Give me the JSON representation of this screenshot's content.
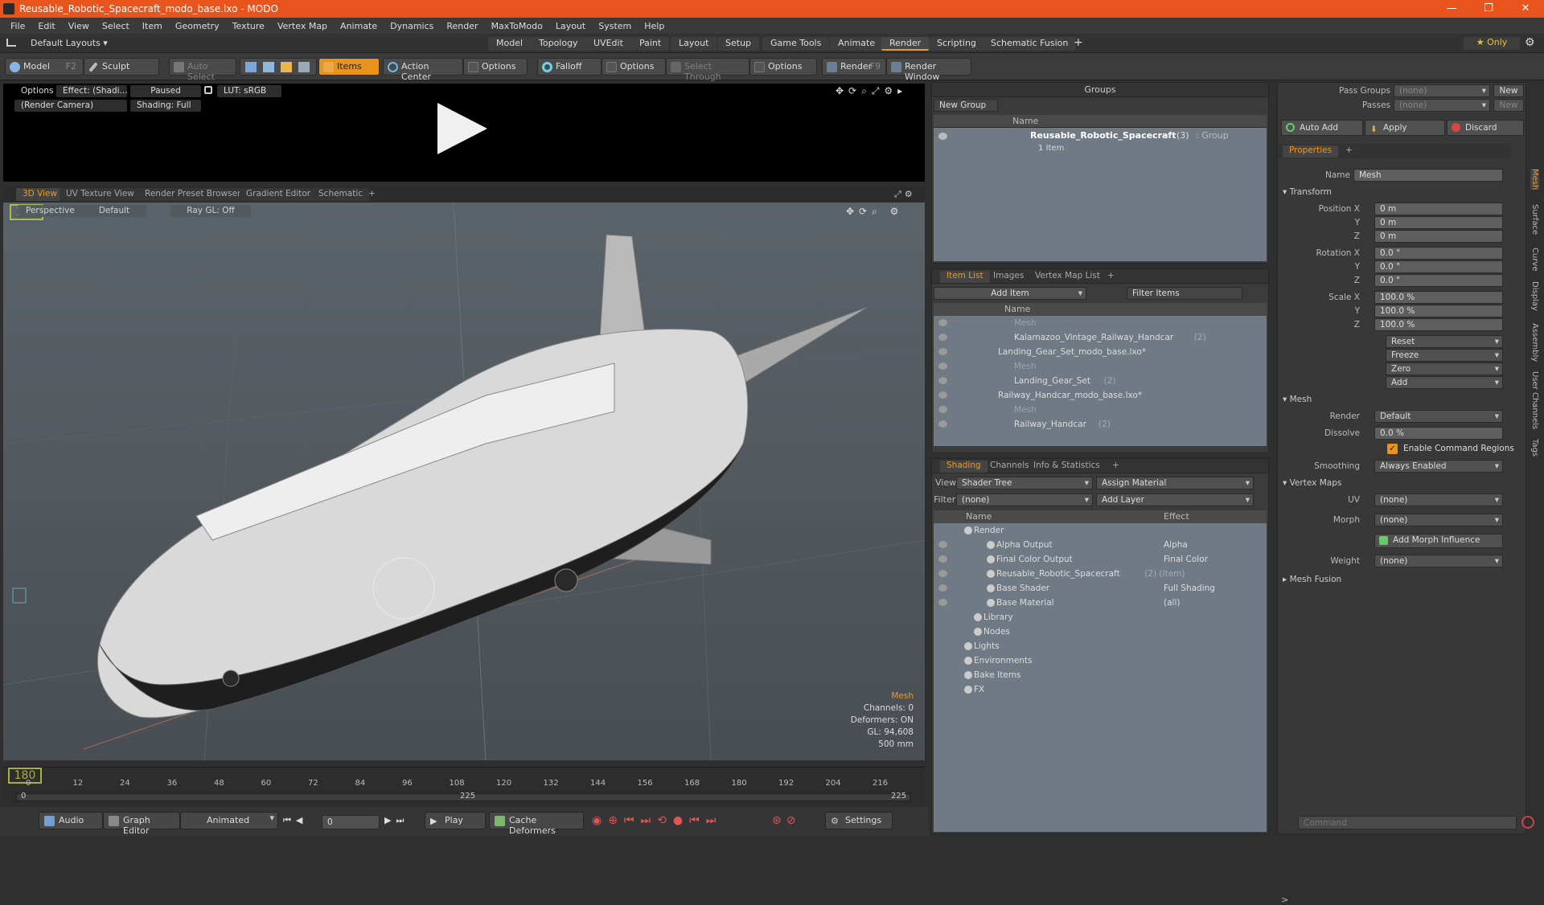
{
  "window": {
    "title": "Reusable_Robotic_Spacecraft_modo_base.lxo - MODO",
    "min": "—",
    "max": "❐",
    "close": "✕"
  },
  "menu": [
    "File",
    "Edit",
    "View",
    "Select",
    "Item",
    "Geometry",
    "Texture",
    "Vertex Map",
    "Animate",
    "Dynamics",
    "Render",
    "MaxToModo",
    "Layout",
    "System",
    "Help"
  ],
  "layout": {
    "default_layouts": "Default Layouts ▾",
    "tabs": [
      "Model",
      "Topology",
      "UVEdit",
      "Paint",
      "Layout",
      "Setup",
      "Game Tools",
      "Animate",
      "Render",
      "Scripting",
      "Schematic Fusion"
    ],
    "active_tab": "Render",
    "add": "+",
    "only": "★  Only"
  },
  "toolbar": {
    "model": "Model",
    "model_key": "F2",
    "sculpt": "Sculpt",
    "auto_select": "Auto Select",
    "items": "Items",
    "action_center": "Action Center",
    "options1": "Options",
    "falloff": "Falloff",
    "options2": "Options",
    "select_through": "Select Through",
    "options3": "Options",
    "render": "Render",
    "render_key": "F9",
    "render_window": "Render Window"
  },
  "render_view": {
    "options": "Options",
    "effect": "Effect: (Shadi...",
    "paused": "Paused",
    "lut": "LUT: sRGB",
    "camera": "(Render Camera)",
    "shading": "Shading: Full"
  },
  "viewport_tabs": [
    "3D View",
    "UV Texture View",
    "Render Preset Browser",
    "Gradient Editor",
    "Schematic",
    "+"
  ],
  "viewport": {
    "perspective": "Perspective",
    "default": "Default",
    "raygl": "Ray GL: Off",
    "stats": {
      "type": "Mesh",
      "channels": "Channels: 0",
      "deformers": "Deformers: ON",
      "gl": "GL: 94,608",
      "scale": "500 mm"
    }
  },
  "timeline": {
    "ticks": [
      "0",
      "12",
      "24",
      "36",
      "48",
      "60",
      "72",
      "84",
      "96",
      "108",
      "120",
      "132",
      "144",
      "156",
      "168",
      "180",
      "192",
      "204",
      "216"
    ],
    "mid": "225",
    "end": "225",
    "start": "0"
  },
  "bottom": {
    "audio": "Audio",
    "graph_editor": "Graph Editor",
    "animated": "Animated",
    "frame": "0",
    "play": "Play",
    "cache_deformers": "Cache Deformers",
    "settings": "Settings"
  },
  "groups": {
    "title": "Groups",
    "new_group": "New Group",
    "col_name": "Name",
    "item_name": "Reusable_Robotic_Spacecraft",
    "item_count": "(3)",
    "item_type": ": Group",
    "item_sub": "1 Item"
  },
  "item_list": {
    "tabs": [
      "Item List",
      "Images",
      "Vertex Map List",
      "+"
    ],
    "add_item": "Add Item",
    "filter": "Filter Items",
    "col_name": "Name",
    "rows": [
      {
        "label": "Mesh",
        "indent": 90,
        "dim": true
      },
      {
        "label": "Kalamazoo_Vintage_Railway_Handcar",
        "count": "(2)",
        "indent": 90,
        "dim": false
      },
      {
        "label": "Landing_Gear_Set_modo_base.lxo*",
        "count": "",
        "indent": 70,
        "dim": false
      },
      {
        "label": "Mesh",
        "indent": 90,
        "dim": true
      },
      {
        "label": "Landing_Gear_Set",
        "count": "(2)",
        "indent": 90,
        "dim": false
      },
      {
        "label": "Railway_Handcar_modo_base.lxo*",
        "count": "",
        "indent": 70,
        "dim": false
      },
      {
        "label": "Mesh",
        "indent": 90,
        "dim": true
      },
      {
        "label": "Railway_Handcar",
        "count": "(2)",
        "indent": 90,
        "dim": false
      }
    ]
  },
  "shading": {
    "tabs": [
      "Shading",
      "Channels",
      "Info & Statistics",
      "+"
    ],
    "view_lbl": "View",
    "view_val": "Shader Tree",
    "assign": "Assign Material",
    "filter_lbl": "Filter",
    "filter_val": "(none)",
    "add_layer": "Add Layer",
    "col_name": "Name",
    "col_effect": "Effect",
    "rows": [
      {
        "label": "Render",
        "effect": "",
        "indent": 50
      },
      {
        "label": "Alpha Output",
        "effect": "Alpha",
        "indent": 78
      },
      {
        "label": "Final Color Output",
        "effect": "Final Color",
        "indent": 78
      },
      {
        "label": "Reusable_Robotic_Spacecraft",
        "count": "(2) (Item)",
        "effect": "",
        "indent": 78
      },
      {
        "label": "Base Shader",
        "effect": "Full Shading",
        "indent": 78
      },
      {
        "label": "Base Material",
        "effect": "(all)",
        "indent": 78
      },
      {
        "label": "Library",
        "effect": "",
        "indent": 62
      },
      {
        "label": "Nodes",
        "effect": "",
        "indent": 62
      },
      {
        "label": "Lights",
        "effect": "",
        "indent": 50
      },
      {
        "label": "Environments",
        "effect": "",
        "indent": 50
      },
      {
        "label": "Bake Items",
        "effect": "",
        "indent": 50
      },
      {
        "label": "FX",
        "effect": "",
        "indent": 50
      }
    ]
  },
  "passes": {
    "pass_groups": "Pass Groups",
    "pass_groups_val": "(none)",
    "passes": "Passes",
    "passes_val": "(none)",
    "new1": "New",
    "new2": "New",
    "auto_add": "Auto Add",
    "apply": "Apply",
    "discard": "Discard"
  },
  "properties": {
    "tab": "Properties",
    "add": "+",
    "name_lbl": "Name",
    "name_val": "Mesh",
    "transform": "Transform",
    "pos_lbl": [
      "Position X",
      "Y",
      "Z"
    ],
    "pos": [
      "0 m",
      "0 m",
      "0 m"
    ],
    "rot_lbl": [
      "Rotation X",
      "Y",
      "Z"
    ],
    "rot": [
      "0.0 °",
      "0.0 °",
      "0.0 °"
    ],
    "scale_lbl": [
      "Scale X",
      "Y",
      "Z"
    ],
    "scale": [
      "100.0 %",
      "100.0 %",
      "100.0 %"
    ],
    "actions": [
      "Reset",
      "Freeze",
      "Zero",
      "Add"
    ],
    "mesh": "Mesh",
    "render_lbl": "Render",
    "render_val": "Default",
    "dissolve_lbl": "Dissolve",
    "dissolve_val": "0.0 %",
    "enable_cmd": "Enable Command Regions",
    "smoothing_lbl": "Smoothing",
    "smoothing_val": "Always Enabled",
    "vertex_maps": "Vertex Maps",
    "uv_lbl": "UV",
    "uv_val": "(none)",
    "morph_lbl": "Morph",
    "morph_val": "(none)",
    "add_morph": "Add Morph Influence",
    "weight_lbl": "Weight",
    "weight_val": "(none)",
    "mesh_fusion": "Mesh Fusion",
    "side_tabs": [
      "Mesh",
      "Surface",
      "Curve",
      "Display",
      "Assembly",
      "User Channels",
      "Tags"
    ]
  },
  "command": {
    "placeholder": "Command",
    "prompt": ">"
  },
  "colors": {
    "accent": "#e89a2a",
    "title": "#e8541c"
  }
}
